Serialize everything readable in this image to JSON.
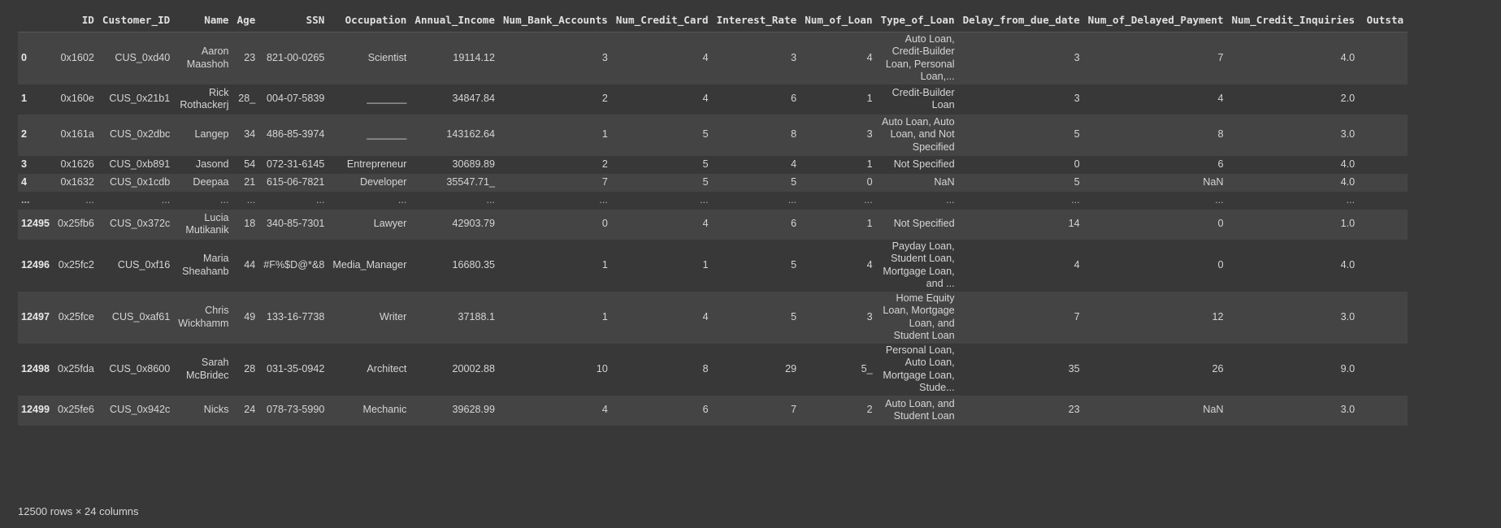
{
  "table": {
    "columns": [
      "",
      "ID",
      "Customer_ID",
      "Name",
      "Age",
      "SSN",
      "Occupation",
      "Annual_Income",
      "Num_Bank_Accounts",
      "Num_Credit_Card",
      "Interest_Rate",
      "Num_of_Loan",
      "Type_of_Loan",
      "Delay_from_due_date",
      "Num_of_Delayed_Payment",
      "Num_Credit_Inquiries",
      "Outsta"
    ],
    "rows": [
      [
        "0",
        "0x1602",
        "CUS_0xd40",
        "Aaron Maashoh",
        "23",
        "821-00-0265",
        "Scientist",
        "19114.12",
        "3",
        "4",
        "3",
        "4",
        "Auto Loan, Credit-Builder Loan, Personal Loan,...",
        "3",
        "7",
        "4.0",
        ""
      ],
      [
        "1",
        "0x160e",
        "CUS_0x21b1",
        "Rick Rothackerj",
        "28_",
        "004-07-5839",
        "_______",
        "34847.84",
        "2",
        "4",
        "6",
        "1",
        "Credit-Builder Loan",
        "3",
        "4",
        "2.0",
        ""
      ],
      [
        "2",
        "0x161a",
        "CUS_0x2dbc",
        "Langep",
        "34",
        "486-85-3974",
        "_______",
        "143162.64",
        "1",
        "5",
        "8",
        "3",
        "Auto Loan, Auto Loan, and Not Specified",
        "5",
        "8",
        "3.0",
        ""
      ],
      [
        "3",
        "0x1626",
        "CUS_0xb891",
        "Jasond",
        "54",
        "072-31-6145",
        "Entrepreneur",
        "30689.89",
        "2",
        "5",
        "4",
        "1",
        "Not Specified",
        "0",
        "6",
        "4.0",
        ""
      ],
      [
        "4",
        "0x1632",
        "CUS_0x1cdb",
        "Deepaa",
        "21",
        "615-06-7821",
        "Developer",
        "35547.71_",
        "7",
        "5",
        "5",
        "0",
        "NaN",
        "5",
        "NaN",
        "4.0",
        ""
      ],
      [
        "...",
        "...",
        "...",
        "...",
        "...",
        "...",
        "...",
        "...",
        "...",
        "...",
        "...",
        "...",
        "...",
        "...",
        "...",
        "...",
        ""
      ],
      [
        "12495",
        "0x25fb6",
        "CUS_0x372c",
        "Lucia Mutikanik",
        "18",
        "340-85-7301",
        "Lawyer",
        "42903.79",
        "0",
        "4",
        "6",
        "1",
        "Not Specified",
        "14",
        "0",
        "1.0",
        ""
      ],
      [
        "12496",
        "0x25fc2",
        "CUS_0xf16",
        "Maria Sheahanb",
        "44",
        "#F%$D@*&8",
        "Media_Manager",
        "16680.35",
        "1",
        "1",
        "5",
        "4",
        "Payday Loan, Student Loan, Mortgage Loan, and ...",
        "4",
        "0",
        "4.0",
        ""
      ],
      [
        "12497",
        "0x25fce",
        "CUS_0xaf61",
        "Chris Wickhamm",
        "49",
        "133-16-7738",
        "Writer",
        "37188.1",
        "1",
        "4",
        "5",
        "3",
        "Home Equity Loan, Mortgage Loan, and Student Loan",
        "7",
        "12",
        "3.0",
        ""
      ],
      [
        "12498",
        "0x25fda",
        "CUS_0x8600",
        "Sarah McBridec",
        "28",
        "031-35-0942",
        "Architect",
        "20002.88",
        "10",
        "8",
        "29",
        "5_",
        "Personal Loan, Auto Loan, Mortgage Loan, Stude...",
        "35",
        "26",
        "9.0",
        ""
      ],
      [
        "12499",
        "0x25fe6",
        "CUS_0x942c",
        "Nicks",
        "24",
        "078-73-5990",
        "Mechanic",
        "39628.99",
        "4",
        "6",
        "7",
        "2",
        "Auto Loan, and Student Loan",
        "23",
        "NaN",
        "3.0",
        ""
      ]
    ]
  },
  "footer": {
    "shape_text": "12500 rows × 24 columns"
  }
}
